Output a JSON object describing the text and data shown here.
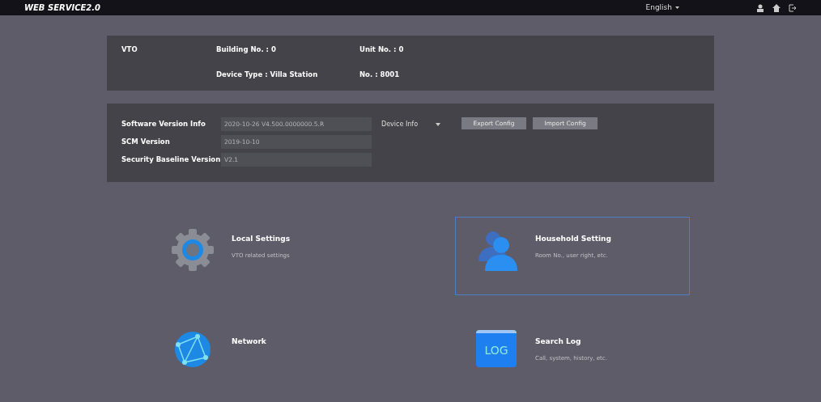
{
  "header": {
    "logo": "WEB SERVICE2.0",
    "language": "English"
  },
  "device": {
    "type": "VTO",
    "fields": [
      {
        "label": "Building No. : 0"
      },
      {
        "label": "Unit No. : 0"
      },
      {
        "label": "Device Type : Villa Station"
      },
      {
        "label": "No. : 8001"
      }
    ]
  },
  "versions": {
    "rows": [
      {
        "label": "Software Version Info",
        "value": "2020-10-26 V4.500.0000000.5.R"
      },
      {
        "label": "SCM Version",
        "value": "2019-10-10"
      },
      {
        "label": "Security Baseline Version",
        "value": "V2.1"
      }
    ],
    "dropdown": "Device Info",
    "buttons": [
      "Export Config",
      "Import Config"
    ]
  },
  "tiles": [
    {
      "kind": "gear",
      "title": "Local Settings",
      "subtitle": "VTO related settings",
      "selected": false
    },
    {
      "kind": "people",
      "title": "Household Setting",
      "subtitle": "Room No., user right, etc.",
      "selected": true
    },
    {
      "kind": "globe",
      "title": "Network",
      "selected": false
    },
    {
      "kind": "log",
      "title": "Search Log",
      "subtitle": "Call, system, history, etc.",
      "icon_text": "LOG",
      "selected": false
    }
  ]
}
